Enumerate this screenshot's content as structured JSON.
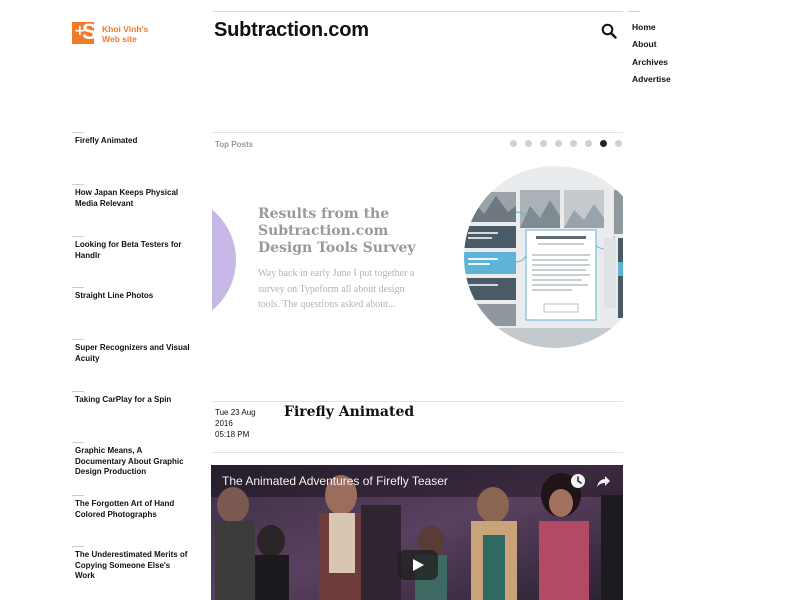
{
  "logo": {
    "mark": "+S",
    "line1": "Khoi Vinh's",
    "line2": "Web site"
  },
  "site_title": "Subtraction.com",
  "nav": {
    "items": [
      "Home",
      "About",
      "Archives",
      "Advertise"
    ]
  },
  "sidebar": {
    "items": [
      "Firefly Animated",
      "How Japan Keeps Physical Media Relevant",
      "Looking for Beta Testers for Handlr",
      "Straight Line Photos",
      "Super Recognizers and Visual Acuity",
      "Taking CarPlay for a Spin",
      "Graphic Means, A Documentary About Graphic Design Production",
      "The Forgotten Art of Hand Colored Photographs",
      "The Underestimated Merits of Copying Someone Else's Work"
    ]
  },
  "top_posts": {
    "label": "Top Posts",
    "dot_count": 8,
    "active_dot": 6
  },
  "slide": {
    "title": "Results from the Subtraction.com Design Tools Survey",
    "excerpt": "Way back in early June I put together a survey on Typeform all about design tools. The questions asked about..."
  },
  "post": {
    "date": "Tue 23 Aug",
    "year": "2016",
    "time": "05:18 PM",
    "title": "Firefly Animated"
  },
  "video": {
    "title": "The Animated Adventures of Firefly Teaser"
  },
  "colors": {
    "accent": "#f07a28",
    "slide_circle": "#c7b8e6",
    "active_dot": "#222222",
    "inactive_dot": "#d0d0d0"
  },
  "icons": [
    "search-icon",
    "clock-icon",
    "share-icon",
    "play-icon"
  ]
}
